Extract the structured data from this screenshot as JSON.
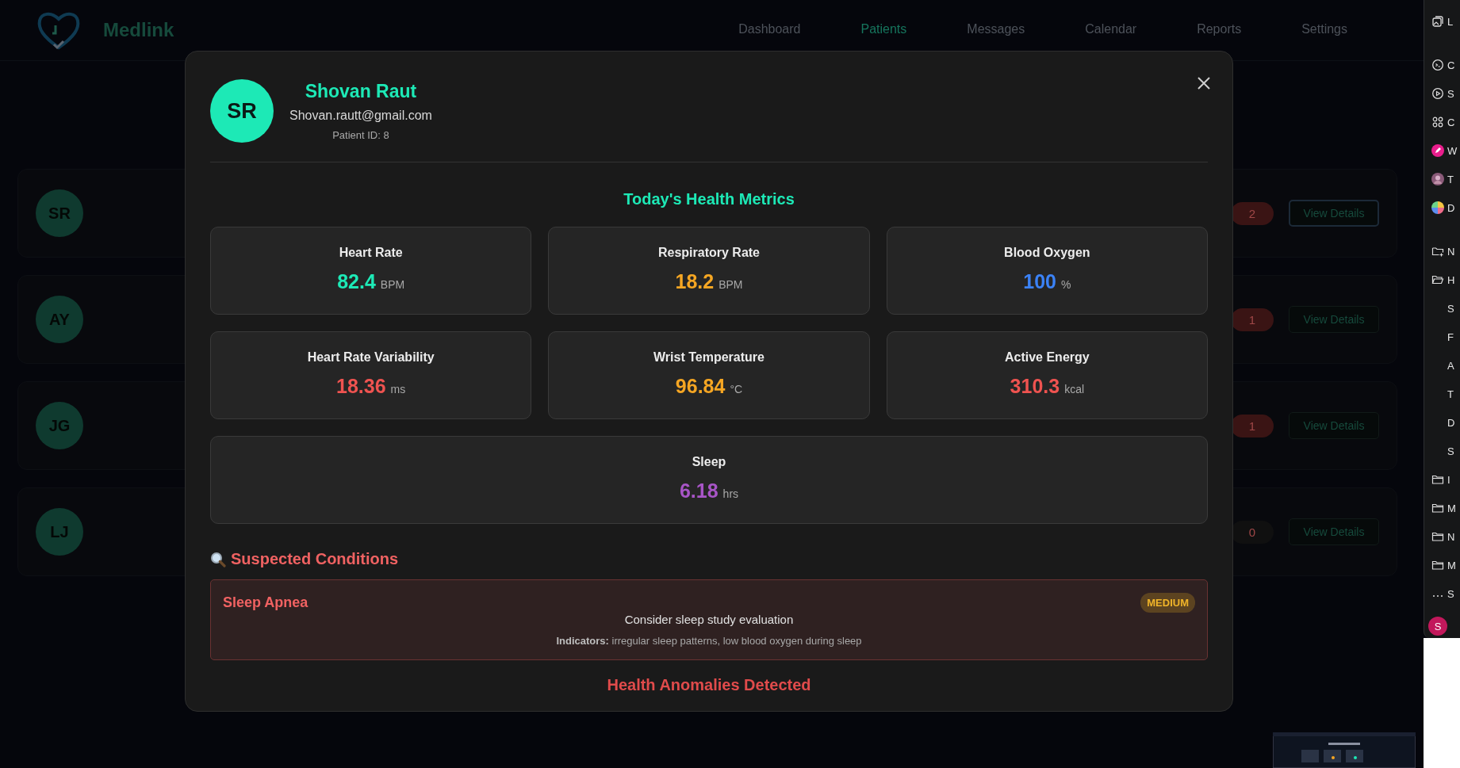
{
  "app": {
    "logo_text": "Medlink"
  },
  "nav": [
    {
      "label": "Dashboard",
      "selected": false
    },
    {
      "label": "Patients",
      "selected": true
    },
    {
      "label": "Messages",
      "selected": false
    },
    {
      "label": "Calendar",
      "selected": false
    },
    {
      "label": "Reports",
      "selected": false
    },
    {
      "label": "Settings",
      "selected": false
    }
  ],
  "patients": [
    {
      "initials": "SR",
      "alerts": "2",
      "color": "#3a1414",
      "focused": true,
      "action": "View Details"
    },
    {
      "initials": "AY",
      "alerts": "1",
      "color": "#3a1414",
      "focused": false,
      "action": "View Details"
    },
    {
      "initials": "JG",
      "alerts": "1",
      "color": "#3a1414",
      "focused": false,
      "action": "View Details"
    },
    {
      "initials": "LJ",
      "alerts": "0",
      "color": "#101010",
      "focused": false,
      "action": "View Details"
    }
  ],
  "modal": {
    "initials": "SR",
    "name": "Shovan Raut",
    "email": "Shovan.rautt@gmail.com",
    "patient_id": "Patient ID: 8",
    "metrics_title": "Today's Health Metrics",
    "metrics": [
      {
        "kind": "tile",
        "label": "Heart Rate",
        "value": "82.4",
        "unit": "BPM",
        "color": "#1de9b6"
      },
      {
        "kind": "tile",
        "label": "Respiratory Rate",
        "value": "18.2",
        "unit": "BPM",
        "color": "#f5a623"
      },
      {
        "kind": "tile",
        "label": "Blood Oxygen",
        "value": "100",
        "unit": "%",
        "color": "#3b82f6"
      },
      {
        "kind": "tile",
        "label": "Heart Rate Variability",
        "value": "18.36",
        "unit": "ms",
        "color": "#ef5350"
      },
      {
        "kind": "tile",
        "label": "Wrist Temperature",
        "value": "96.84",
        "unit": "°C",
        "color": "#f5a623"
      },
      {
        "kind": "tile",
        "label": "Active Energy",
        "value": "310.3",
        "unit": "kcal",
        "color": "#ef5350"
      },
      {
        "kind": "wide",
        "label": "Sleep",
        "value": "6.18",
        "unit": "hrs",
        "color": "#a855c7"
      }
    ],
    "conditions_title": "Suspected Conditions",
    "conditions": [
      {
        "name": "Sleep Apnea",
        "severity": "MEDIUM",
        "recommendation": "Consider sleep study evaluation",
        "indicators": "**Indicators:** irregular sleep patterns, low blood oxygen during sleep"
      }
    ],
    "anomalies_title": "Health Anomalies Detected"
  },
  "sidebar": [
    [
      {
        "kind": "gallery",
        "label": "L"
      }
    ],
    [
      {
        "kind": "terminal",
        "label": "C"
      },
      {
        "kind": "play",
        "label": "S"
      },
      {
        "kind": "apps",
        "label": "C"
      },
      {
        "kind": "pencil",
        "label": "W"
      },
      {
        "kind": "photo",
        "label": "T"
      },
      {
        "kind": "wheel",
        "label": "D"
      }
    ],
    [
      {
        "kind": "folder-plus",
        "label": "N"
      },
      {
        "kind": "folder-open",
        "label": "H"
      },
      {
        "kind": "none",
        "label": "S"
      },
      {
        "kind": "none",
        "label": "F"
      },
      {
        "kind": "none",
        "label": "A"
      },
      {
        "kind": "none",
        "label": "T"
      },
      {
        "kind": "none",
        "label": "D"
      },
      {
        "kind": "none",
        "label": "S"
      },
      {
        "kind": "folder",
        "label": "I"
      },
      {
        "kind": "folder",
        "label": "M"
      },
      {
        "kind": "folder",
        "label": "N"
      },
      {
        "kind": "folder",
        "label": "M"
      },
      {
        "kind": "dots",
        "label": "S"
      }
    ],
    [
      {
        "kind": "user",
        "initial": "S"
      }
    ]
  ]
}
